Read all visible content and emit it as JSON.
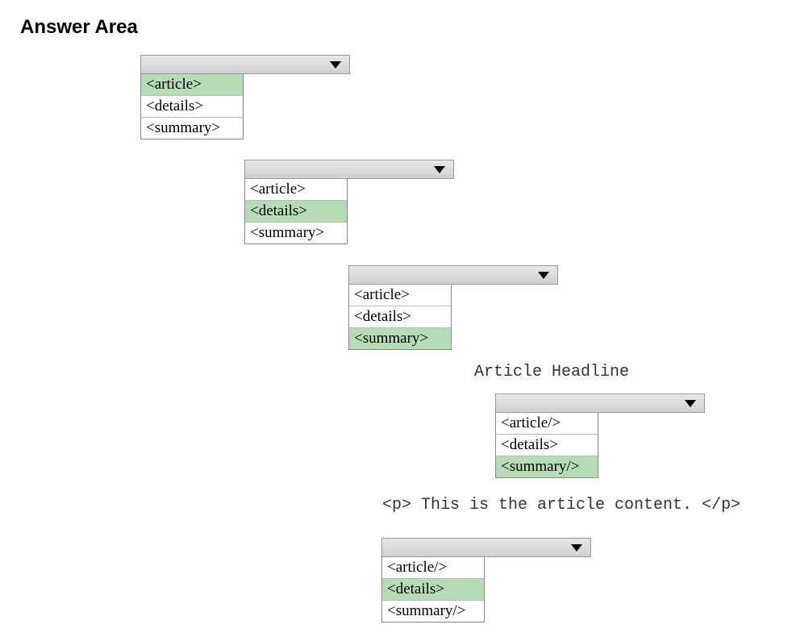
{
  "page_title": "Answer Area",
  "blocks": {
    "b1": {
      "options": [
        "<article>",
        "<details>",
        "<summary>"
      ],
      "selected_index": 0
    },
    "b2": {
      "options": [
        "<article>",
        "<details>",
        "<summary>"
      ],
      "selected_index": 1
    },
    "b3": {
      "options": [
        "<article>",
        "<details>",
        "<summary>"
      ],
      "selected_index": 2
    },
    "b4": {
      "options": [
        "<article/>",
        "<details>",
        "<summary/>"
      ],
      "selected_index": 2
    },
    "b5": {
      "options": [
        "<article/>",
        "<details>",
        "<summary/>"
      ],
      "selected_index": 1
    }
  },
  "texts": {
    "headline": "Article Headline",
    "paragraph": "<p> This is the article content. </p>"
  }
}
